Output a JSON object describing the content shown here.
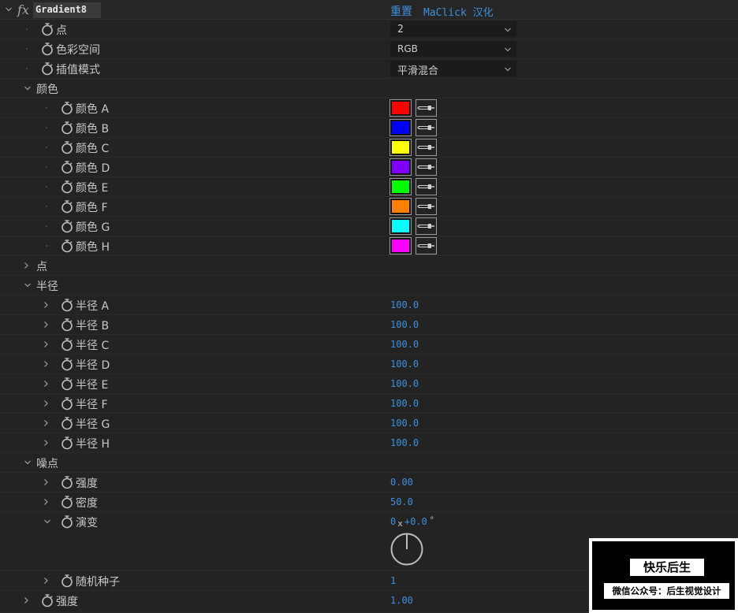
{
  "effect": {
    "fx_label": "fx",
    "name": "Gradient8",
    "reset_label": "重置",
    "plugin_label": "MaClick 汉化"
  },
  "rows": {
    "point_count": {
      "label": "点",
      "value": "2"
    },
    "color_space": {
      "label": "色彩空间",
      "value": "RGB"
    },
    "interp_mode": {
      "label": "插值模式",
      "value": "平滑混合"
    },
    "colors_group": {
      "label": "颜色"
    },
    "color_a": {
      "label": "颜色 A",
      "color": "#ff0000"
    },
    "color_b": {
      "label": "颜色 B",
      "color": "#0000ff"
    },
    "color_c": {
      "label": "颜色 C",
      "color": "#ffff00"
    },
    "color_d": {
      "label": "颜色 D",
      "color": "#8000ff"
    },
    "color_e": {
      "label": "颜色 E",
      "color": "#00ff00"
    },
    "color_f": {
      "label": "颜色 F",
      "color": "#ff8000"
    },
    "color_g": {
      "label": "颜色 G",
      "color": "#00ffff"
    },
    "color_h": {
      "label": "颜色 H",
      "color": "#ff00ff"
    },
    "points_group": {
      "label": "点"
    },
    "radius_group": {
      "label": "半径"
    },
    "radius_a": {
      "label": "半径 A",
      "value": "100.0"
    },
    "radius_b": {
      "label": "半径 B",
      "value": "100.0"
    },
    "radius_c": {
      "label": "半径 C",
      "value": "100.0"
    },
    "radius_d": {
      "label": "半径 D",
      "value": "100.0"
    },
    "radius_e": {
      "label": "半径 E",
      "value": "100.0"
    },
    "radius_f": {
      "label": "半径 F",
      "value": "100.0"
    },
    "radius_g": {
      "label": "半径 G",
      "value": "100.0"
    },
    "radius_h": {
      "label": "半径 H",
      "value": "100.0"
    },
    "noise_group": {
      "label": "噪点"
    },
    "noise_strength": {
      "label": "强度",
      "value": "0.00"
    },
    "noise_density": {
      "label": "密度",
      "value": "50.0"
    },
    "evolution": {
      "label": "演变",
      "revolutions": "0",
      "x_sep": "x",
      "degrees": "+0.0",
      "degree_sign": "°"
    },
    "random_seed": {
      "label": "随机种子",
      "value": "1"
    },
    "strength": {
      "label": "强度",
      "value": "1.00"
    }
  },
  "watermark": {
    "title": "快乐后生",
    "subtitle": "微信公众号：后生视觉设计"
  },
  "accent_color": "#3f8fdd"
}
